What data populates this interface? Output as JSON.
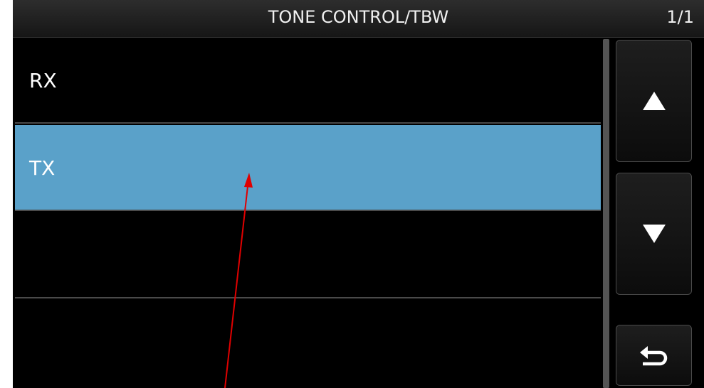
{
  "header": {
    "title": "TONE CONTROL/TBW",
    "page": "1/1"
  },
  "list": {
    "items": [
      {
        "label": "RX",
        "selected": false
      },
      {
        "label": "TX",
        "selected": true
      },
      {
        "label": "",
        "selected": false
      },
      {
        "label": "",
        "selected": false
      }
    ]
  },
  "buttons": {
    "scroll_up_icon": "up-triangle",
    "scroll_down_icon": "down-triangle",
    "back_icon": "return-arrow"
  },
  "colors": {
    "selected_row": "#5aa1c9",
    "annotation_arrow": "#e00000"
  }
}
